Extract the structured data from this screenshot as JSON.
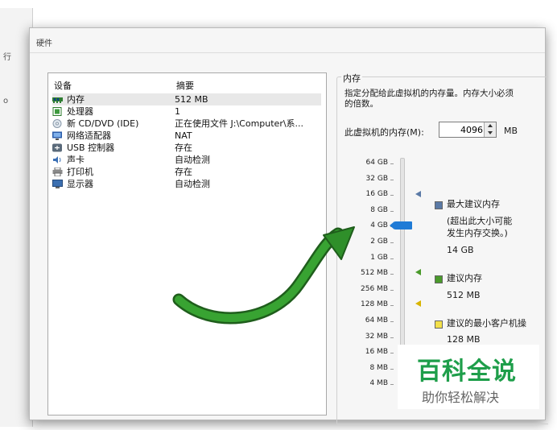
{
  "background": {
    "fragments": [
      "行",
      "o"
    ]
  },
  "dialog": {
    "title": "硬件"
  },
  "devices": {
    "header_device": "设备",
    "header_summary": "摘要",
    "rows": [
      {
        "name": "内存",
        "summary": "512 MB",
        "icon": "memory-icon"
      },
      {
        "name": "处理器",
        "summary": "1",
        "icon": "processor-icon"
      },
      {
        "name": "新 CD/DVD (IDE)",
        "summary": "正在使用文件 J:\\Computer\\系...",
        "icon": "cd-dvd-icon"
      },
      {
        "name": "网络适配器",
        "summary": "NAT",
        "icon": "network-adapter-icon"
      },
      {
        "name": "USB 控制器",
        "summary": "存在",
        "icon": "usb-controller-icon"
      },
      {
        "name": "声卡",
        "summary": "自动检测",
        "icon": "sound-card-icon"
      },
      {
        "name": "打印机",
        "summary": "存在",
        "icon": "printer-icon"
      },
      {
        "name": "显示器",
        "summary": "自动检测",
        "icon": "display-icon"
      }
    ]
  },
  "memory": {
    "legend": "内存",
    "description": "指定分配给此虚拟机的内存量。内存大小必须为 4 MB 的倍数。",
    "description_line1": "指定分配给此虚拟机的内存量。内存大小必须",
    "description_line2": "的倍数。",
    "field_label": "此虚拟机的内存(M):",
    "value": "4096",
    "unit": "MB",
    "scale": [
      "64 GB",
      "32 GB",
      "16 GB",
      "8 GB",
      "4 GB",
      "2 GB",
      "1 GB",
      "512 MB",
      "256 MB",
      "128 MB",
      "64 MB",
      "32 MB",
      "16 MB",
      "8 MB",
      "4 MB"
    ],
    "current_level": "4 GB",
    "max_recommended": {
      "title": "最大建议内存",
      "note_line1": "(超出此大小可能",
      "note_line2": "发生内存交换。)",
      "value": "14 GB",
      "color": "#5b7aa6"
    },
    "recommended": {
      "title": "建议内存",
      "value": "512 MB",
      "color": "#4a9a2b"
    },
    "min_guest": {
      "title": "建议的最小客户机操",
      "value": "128 MB",
      "color": "#d8b400"
    }
  },
  "colors": {
    "accent": "#1f7bd6",
    "arrow": "#2f8f2a"
  },
  "watermark": {
    "main": "百科全说",
    "sub": "助你轻松解决"
  }
}
